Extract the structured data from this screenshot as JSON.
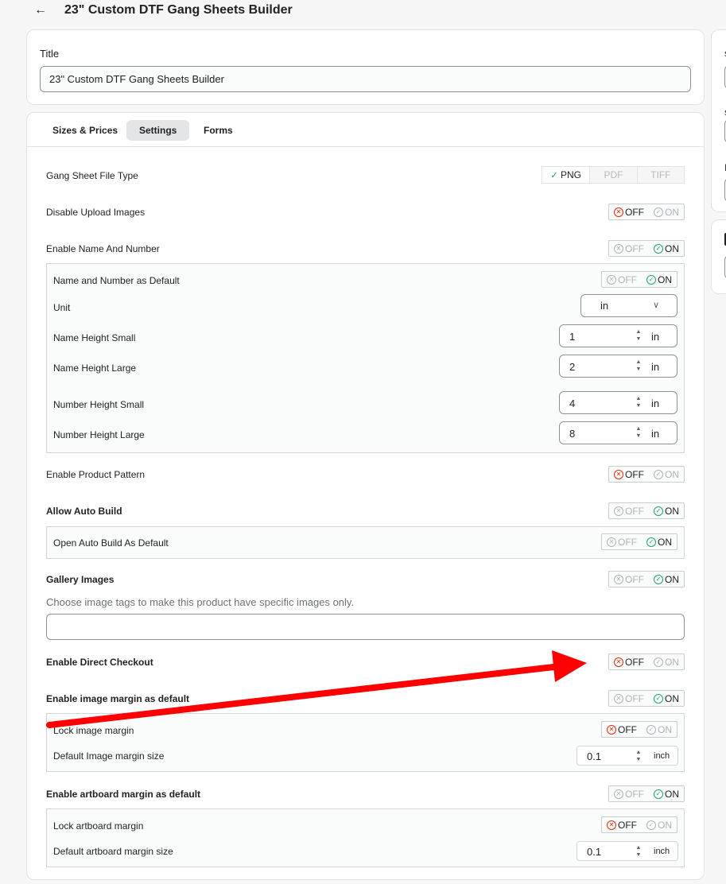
{
  "header": {
    "title": "23\" Custom DTF Gang Sheets Builder"
  },
  "title_card": {
    "label": "Title",
    "value": "23\" Custom DTF Gang Sheets Builder"
  },
  "tabs": [
    {
      "label": "Sizes & Prices",
      "active": false
    },
    {
      "label": "Settings",
      "active": true
    },
    {
      "label": "Forms",
      "active": false
    }
  ],
  "toggle_text": {
    "off": "OFF",
    "on": "ON"
  },
  "file_type": {
    "label": "Gang Sheet File Type",
    "options": [
      "PNG",
      "PDF",
      "TIFF"
    ],
    "selected": "PNG"
  },
  "settings": {
    "disable_upload": {
      "label": "Disable Upload Images",
      "state": "OFF"
    },
    "name_number": {
      "label": "Enable Name And Number",
      "state": "ON"
    },
    "name_number_default": {
      "label": "Name and Number as Default",
      "state": "ON"
    },
    "unit": {
      "label": "Unit",
      "value": "in"
    },
    "name_small": {
      "label": "Name Height Small",
      "value": "1",
      "unit": "in"
    },
    "name_large": {
      "label": "Name Height Large",
      "value": "2",
      "unit": "in"
    },
    "number_small": {
      "label": "Number Height Small",
      "value": "4",
      "unit": "in"
    },
    "number_large": {
      "label": "Number Height Large",
      "value": "8",
      "unit": "in"
    },
    "product_pattern": {
      "label": "Enable Product Pattern",
      "state": "OFF"
    },
    "auto_build": {
      "label": "Allow Auto Build",
      "state": "ON"
    },
    "auto_build_default": {
      "label": "Open Auto Build As Default",
      "state": "ON"
    },
    "gallery": {
      "label": "Gallery Images",
      "state": "ON",
      "hint": "Choose image tags to make this product have specific images only.",
      "tags_value": ""
    },
    "direct_checkout": {
      "label": "Enable Direct Checkout",
      "state": "OFF"
    },
    "image_margin": {
      "label": "Enable image margin as default",
      "state": "ON"
    },
    "lock_image_margin": {
      "label": "Lock image margin",
      "state": "OFF"
    },
    "image_margin_size": {
      "label": "Default Image margin size",
      "value": "0.1",
      "unit": "inch"
    },
    "artboard_margin": {
      "label": "Enable artboard margin as default",
      "state": "ON"
    },
    "lock_artboard_margin": {
      "label": "Lock artboard margin",
      "state": "OFF"
    },
    "artboard_margin_size": {
      "label": "Default artboard margin size",
      "value": "0.1",
      "unit": "inch"
    }
  },
  "colors": {
    "off_active": "#d72c0d",
    "on_active": "#21a366",
    "annotation_arrow": "#ff0000"
  }
}
